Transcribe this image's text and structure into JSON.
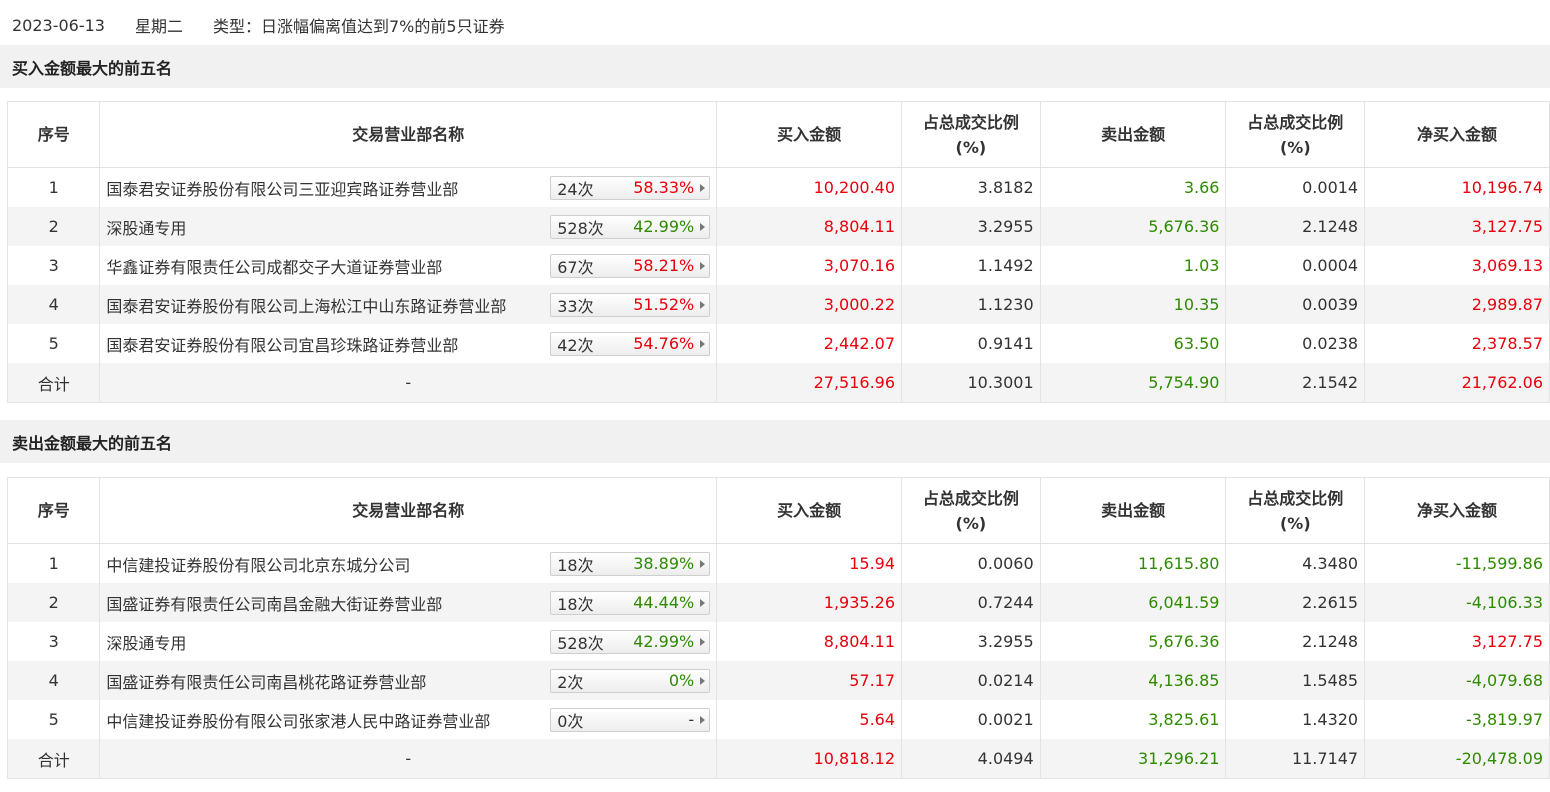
{
  "info": {
    "date": "2023-06-13",
    "weekday": "星期二",
    "type_text": "类型：日涨幅偏离值达到7%的前5只证券"
  },
  "columns": {
    "idx": "序号",
    "name": "交易营业部名称",
    "buy": "买入金额",
    "buy_ratio_l1": "占总成交比例",
    "buy_ratio_l2": "(%)",
    "sell": "卖出金额",
    "sell_ratio_l1": "占总成交比例",
    "sell_ratio_l2": "(%)",
    "net": "净买入金额"
  },
  "colors": {
    "up": "#e8000b",
    "down": "#2e8b00"
  },
  "buy_section": {
    "title": "买入金额最大的前五名",
    "rows": [
      {
        "idx": "1",
        "name": "国泰君安证券股份有限公司三亚迎宾路证券营业部",
        "count": "24次",
        "rate": "58.33%",
        "rate_color": "red",
        "buy": "10,200.40",
        "buy_ratio": "3.8182",
        "sell": "3.66",
        "sell_ratio": "0.0014",
        "net": "10,196.74",
        "net_color": "red"
      },
      {
        "idx": "2",
        "name": "深股通专用",
        "count": "528次",
        "rate": "42.99%",
        "rate_color": "green",
        "buy": "8,804.11",
        "buy_ratio": "3.2955",
        "sell": "5,676.36",
        "sell_ratio": "2.1248",
        "net": "3,127.75",
        "net_color": "red"
      },
      {
        "idx": "3",
        "name": "华鑫证券有限责任公司成都交子大道证券营业部",
        "count": "67次",
        "rate": "58.21%",
        "rate_color": "red",
        "buy": "3,070.16",
        "buy_ratio": "1.1492",
        "sell": "1.03",
        "sell_ratio": "0.0004",
        "net": "3,069.13",
        "net_color": "red"
      },
      {
        "idx": "4",
        "name": "国泰君安证券股份有限公司上海松江中山东路证券营业部",
        "count": "33次",
        "rate": "51.52%",
        "rate_color": "red",
        "buy": "3,000.22",
        "buy_ratio": "1.1230",
        "sell": "10.35",
        "sell_ratio": "0.0039",
        "net": "2,989.87",
        "net_color": "red"
      },
      {
        "idx": "5",
        "name": "国泰君安证券股份有限公司宜昌珍珠路证券营业部",
        "count": "42次",
        "rate": "54.76%",
        "rate_color": "red",
        "buy": "2,442.07",
        "buy_ratio": "0.9141",
        "sell": "63.50",
        "sell_ratio": "0.0238",
        "net": "2,378.57",
        "net_color": "red"
      }
    ],
    "total": {
      "label": "合计",
      "name": "-",
      "buy": "27,516.96",
      "buy_ratio": "10.3001",
      "sell": "5,754.90",
      "sell_ratio": "2.1542",
      "net": "21,762.06",
      "net_color": "red"
    }
  },
  "sell_section": {
    "title": "卖出金额最大的前五名",
    "rows": [
      {
        "idx": "1",
        "name": "中信建投证券股份有限公司北京东城分公司",
        "count": "18次",
        "rate": "38.89%",
        "rate_color": "green",
        "buy": "15.94",
        "buy_ratio": "0.0060",
        "sell": "11,615.80",
        "sell_ratio": "4.3480",
        "net": "-11,599.86",
        "net_color": "green"
      },
      {
        "idx": "2",
        "name": "国盛证券有限责任公司南昌金融大街证券营业部",
        "count": "18次",
        "rate": "44.44%",
        "rate_color": "green",
        "buy": "1,935.26",
        "buy_ratio": "0.7244",
        "sell": "6,041.59",
        "sell_ratio": "2.2615",
        "net": "-4,106.33",
        "net_color": "green"
      },
      {
        "idx": "3",
        "name": "深股通专用",
        "count": "528次",
        "rate": "42.99%",
        "rate_color": "green",
        "buy": "8,804.11",
        "buy_ratio": "3.2955",
        "sell": "5,676.36",
        "sell_ratio": "2.1248",
        "net": "3,127.75",
        "net_color": "red"
      },
      {
        "idx": "4",
        "name": "国盛证券有限责任公司南昌桃花路证券营业部",
        "count": "2次",
        "rate": "0%",
        "rate_color": "green",
        "buy": "57.17",
        "buy_ratio": "0.0214",
        "sell": "4,136.85",
        "sell_ratio": "1.5485",
        "net": "-4,079.68",
        "net_color": "green"
      },
      {
        "idx": "5",
        "name": "中信建投证券股份有限公司张家港人民中路证券营业部",
        "count": "0次",
        "rate": "-",
        "rate_color": "dash",
        "buy": "5.64",
        "buy_ratio": "0.0021",
        "sell": "3,825.61",
        "sell_ratio": "1.4320",
        "net": "-3,819.97",
        "net_color": "green"
      }
    ],
    "total": {
      "label": "合计",
      "name": "-",
      "buy": "10,818.12",
      "buy_ratio": "4.0494",
      "sell": "31,296.21",
      "sell_ratio": "11.7147",
      "net": "-20,478.09",
      "net_color": "green"
    }
  }
}
